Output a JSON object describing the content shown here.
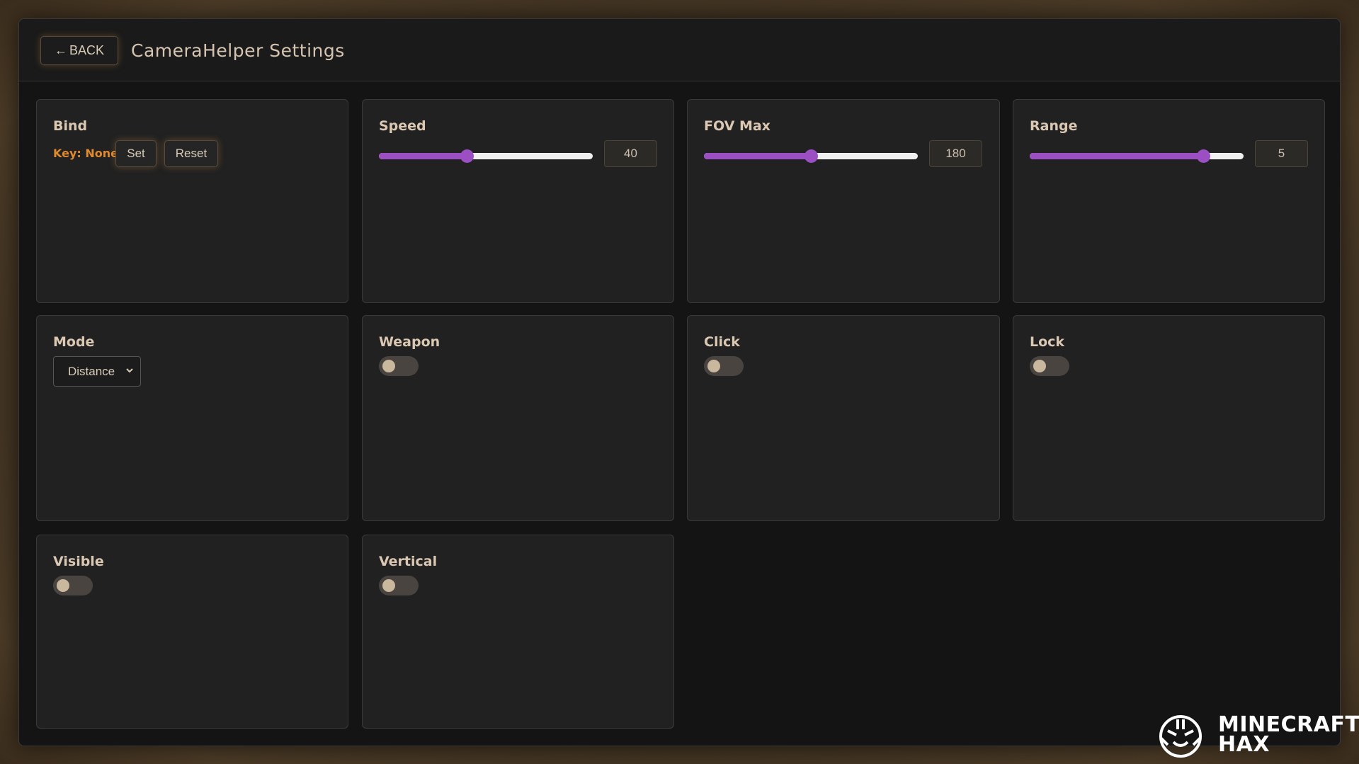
{
  "header": {
    "back_label": "BACK",
    "back_arrow": "←",
    "title": "CameraHelper Settings"
  },
  "bind": {
    "label": "Bind",
    "key_text": "Key: None",
    "set_label": "Set",
    "reset_label": "Reset"
  },
  "speed": {
    "label": "Speed",
    "value": "40",
    "fraction": 0.41
  },
  "fov_max": {
    "label": "FOV Max",
    "value": "180",
    "fraction": 0.5
  },
  "range": {
    "label": "Range",
    "value": "5",
    "fraction": 0.81
  },
  "mode": {
    "label": "Mode",
    "selected": "Distance"
  },
  "weapon": {
    "label": "Weapon",
    "enabled": false
  },
  "click": {
    "label": "Click",
    "enabled": false
  },
  "lock": {
    "label": "Lock",
    "enabled": false
  },
  "visible": {
    "label": "Visible",
    "enabled": false
  },
  "vertical": {
    "label": "Vertical",
    "enabled": false
  },
  "logo": {
    "line1": "MINECRAFT",
    "line2": "HAX"
  },
  "colors": {
    "accent": "#9b4fc3",
    "key_text": "#e0892e",
    "card": "#212121",
    "panel": "#141414"
  }
}
